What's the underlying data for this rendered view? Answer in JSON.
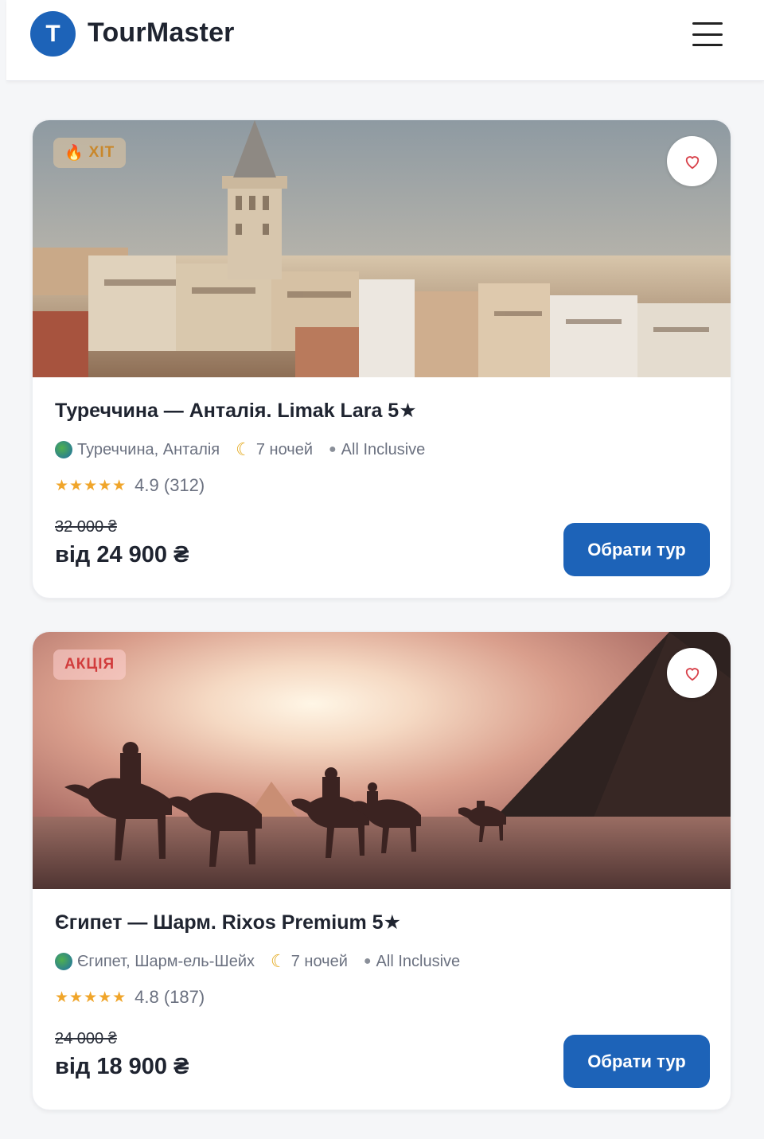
{
  "header": {
    "logo_letter": "T",
    "brand": "TourMaster",
    "menu_icon": "hamburger-icon"
  },
  "colors": {
    "primary": "#1d63b8",
    "star": "#f0a52a",
    "hot_badge": "#c9872a",
    "sale_badge": "#d13c3c"
  },
  "tours": [
    {
      "badge": "ХІТ",
      "badge_icon": "fire-icon",
      "title": "Туреччина — Анталія. Limak Lara 5★",
      "location": "Туреччина, Анталія",
      "nights": "7 ночей",
      "board": "All Inclusive",
      "stars": "★★★★★",
      "rating": "4.9 (312)",
      "old_price": "32 000 ₴",
      "price": "від 24 900 ₴",
      "cta": "Обрати тур"
    },
    {
      "badge": "АКЦІЯ",
      "title": "Єгипет — Шарм. Rixos Premium 5★",
      "location": "Єгипет, Шарм-ель-Шейх",
      "nights": "7 ночей",
      "board": "All Inclusive",
      "stars": "★★★★★",
      "rating": "4.8 (187)",
      "old_price": "24 000 ₴",
      "price": "від 18 900 ₴",
      "cta": "Обрати тур"
    }
  ]
}
